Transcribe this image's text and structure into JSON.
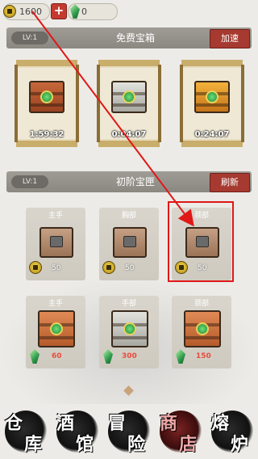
{
  "topbar": {
    "gold": "1600",
    "gems": "0",
    "icons": {
      "gold": "coin-icon",
      "add": "plus-icon",
      "gem": "gem-icon"
    }
  },
  "free_section": {
    "level": "LV:1",
    "title": "免费宝箱",
    "action": "加速",
    "chests": [
      {
        "timer": "1:59:32",
        "kind": "wood-chest"
      },
      {
        "timer": "0:04:07",
        "kind": "stone-chest"
      },
      {
        "timer": "0:24:07",
        "kind": "gold-chest"
      }
    ]
  },
  "box_section": {
    "level": "LV:1",
    "title": "初阶宝匣",
    "action": "刷新",
    "row1": [
      {
        "name": "主手",
        "price": "50",
        "currency": "coin"
      },
      {
        "name": "胸部",
        "price": "50",
        "currency": "coin"
      },
      {
        "name": "颈部",
        "price": "50",
        "currency": "coin"
      }
    ],
    "row2": [
      {
        "name": "主手",
        "price": "60",
        "currency": "gem"
      },
      {
        "name": "手部",
        "price": "300",
        "currency": "gem"
      },
      {
        "name": "颈部",
        "price": "150",
        "currency": "gem"
      }
    ]
  },
  "bottom_nav": [
    {
      "c1": "仓",
      "c2": "库",
      "active": false
    },
    {
      "c1": "酒",
      "c2": "馆",
      "active": false
    },
    {
      "c1": "冒",
      "c2": "险",
      "active": false
    },
    {
      "c1": "商",
      "c2": "店",
      "active": true
    },
    {
      "c1": "熔",
      "c2": "炉",
      "active": false
    }
  ],
  "colors": {
    "accent_red": "#a63a30",
    "annotation": "#e01818",
    "gem_price": "#e84c3f"
  }
}
